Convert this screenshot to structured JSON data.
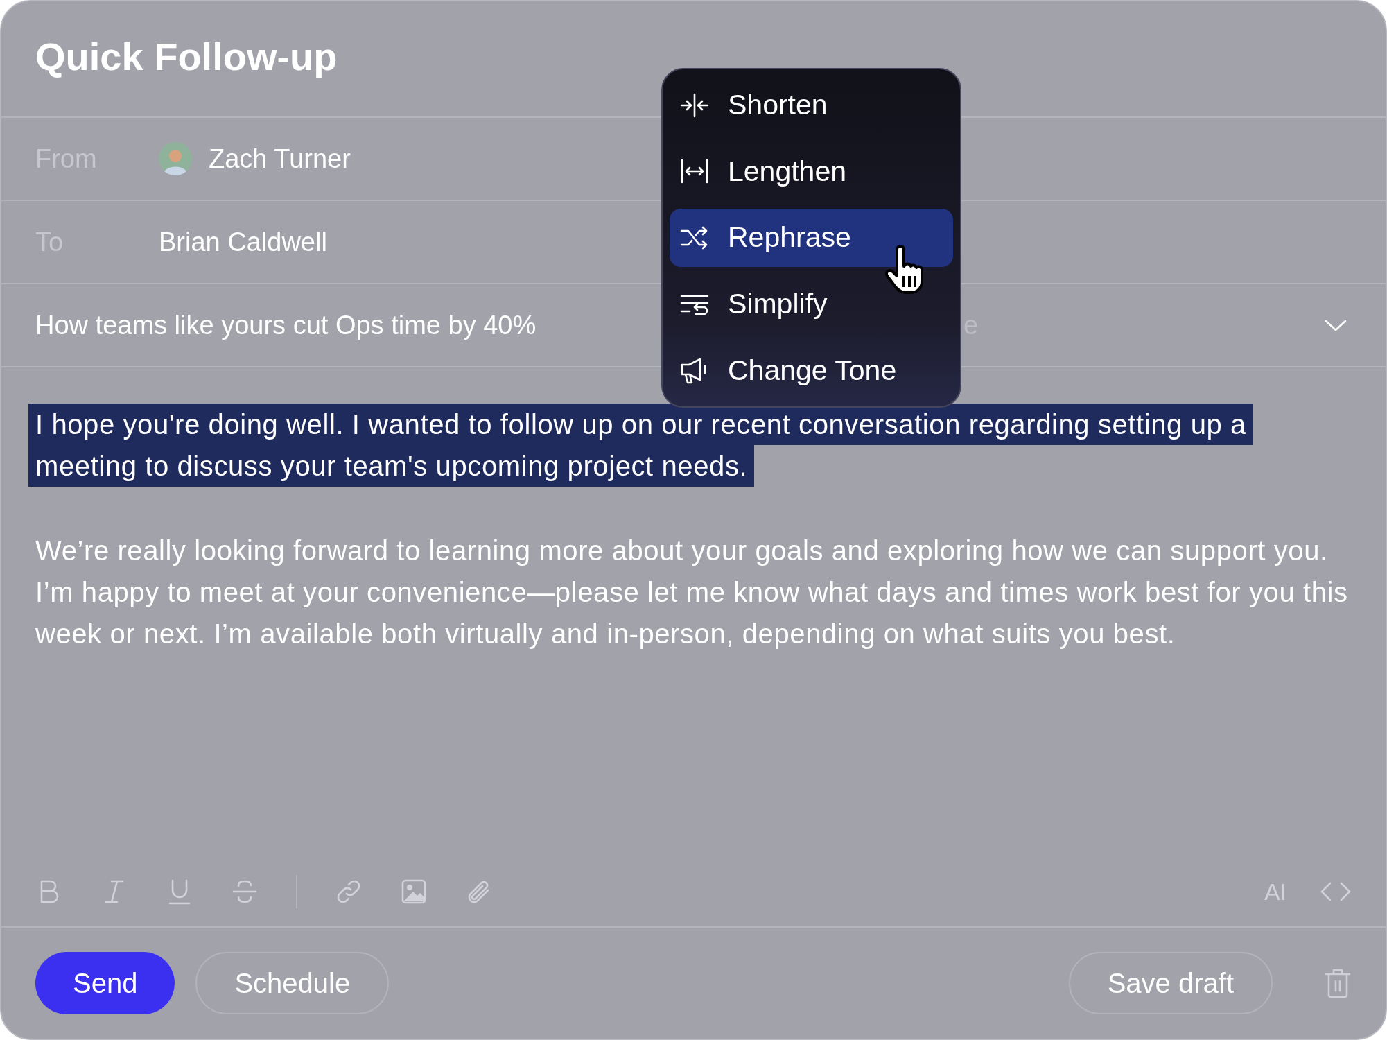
{
  "title": "Quick Follow-up",
  "from": {
    "label": "From",
    "name": "Zach Turner"
  },
  "to": {
    "label": "To",
    "value": "Brian Caldwell"
  },
  "subject": {
    "value": "How teams like yours cut Ops time by 40%",
    "column_3": "e"
  },
  "body": [
    {
      "text": "I hope you're doing well. I wanted to follow up on our recent conversation regarding setting up a meeting to discuss your team's upcoming project needs.",
      "selected": true
    },
    {
      "text": "We’re really looking forward to learning more about your goals and exploring how we can support you. I’m happy to meet at your convenience—please let me know what days and times work best for you this week or next. I’m available both virtually and in-person, depending on what suits you best.",
      "selected": false
    }
  ],
  "menu": [
    {
      "kind": "shorten",
      "label": "Shorten",
      "selected": false
    },
    {
      "kind": "lengthen",
      "label": "Lengthen",
      "selected": false
    },
    {
      "kind": "rephrase",
      "label": "Rephrase",
      "selected": true
    },
    {
      "kind": "simplify",
      "label": "Simplify",
      "selected": false
    },
    {
      "kind": "tone",
      "label": "Change Tone",
      "selected": false
    }
  ],
  "toolbar": [
    {
      "kind": "bold"
    },
    {
      "kind": "italic"
    },
    {
      "kind": "underline"
    },
    {
      "kind": "strike"
    },
    {
      "kind": "divider"
    },
    {
      "kind": "link"
    },
    {
      "kind": "image"
    },
    {
      "kind": "attach"
    }
  ],
  "toolbar_right": {
    "ai": "AI"
  },
  "buttons": [
    {
      "kind": "primary",
      "label": "Send"
    },
    {
      "kind": "outline",
      "label": "Schedule"
    }
  ],
  "buttons_right": [
    {
      "kind": "outline",
      "label": "Save draft"
    }
  ]
}
